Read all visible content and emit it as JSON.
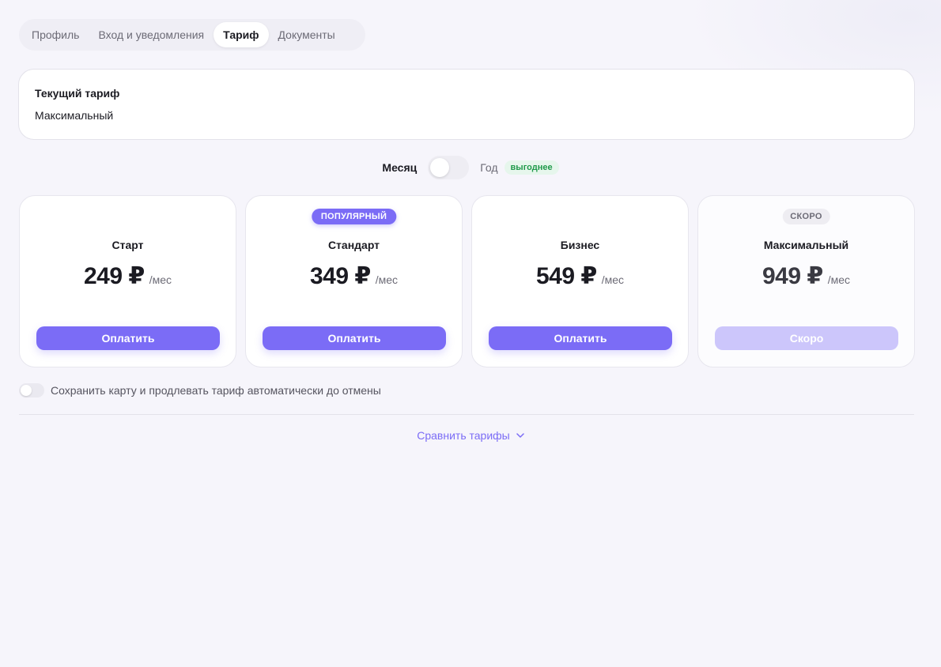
{
  "tabs": [
    {
      "label": "Профиль",
      "active": false
    },
    {
      "label": "Вход и уведомления",
      "active": false
    },
    {
      "label": "Тариф",
      "active": true
    },
    {
      "label": "Документы",
      "active": false
    }
  ],
  "current_plan": {
    "label": "Текущий тариф",
    "value": "Максимальный"
  },
  "billing_period": {
    "month_label": "Месяц",
    "year_label": "Год",
    "year_badge": "выгоднее",
    "selected": "Месяц"
  },
  "plans": [
    {
      "name": "Старт",
      "price": "249 ₽",
      "period": "/мес",
      "badge": "",
      "button": "Оплатить",
      "disabled": false
    },
    {
      "name": "Стандарт",
      "price": "349 ₽",
      "period": "/мес",
      "badge": "ПОПУЛЯРНЫЙ",
      "button": "Оплатить",
      "disabled": false
    },
    {
      "name": "Бизнес",
      "price": "549 ₽",
      "period": "/мес",
      "badge": "",
      "button": "Оплатить",
      "disabled": false
    },
    {
      "name": "Максимальный",
      "price": "949 ₽",
      "period": "/мес",
      "badge": "СКОРО",
      "button": "Скоро",
      "disabled": true
    }
  ],
  "autorenew": {
    "label": "Сохранить карту и продлевать тариф автоматически до отмены",
    "enabled": false
  },
  "compare": {
    "label": "Сравнить тарифы",
    "icon": "chevron-down-icon"
  },
  "colors": {
    "accent": "#7b6cf6",
    "accent_disabled": "#ccc6fb",
    "success": "#1f9a4a"
  }
}
